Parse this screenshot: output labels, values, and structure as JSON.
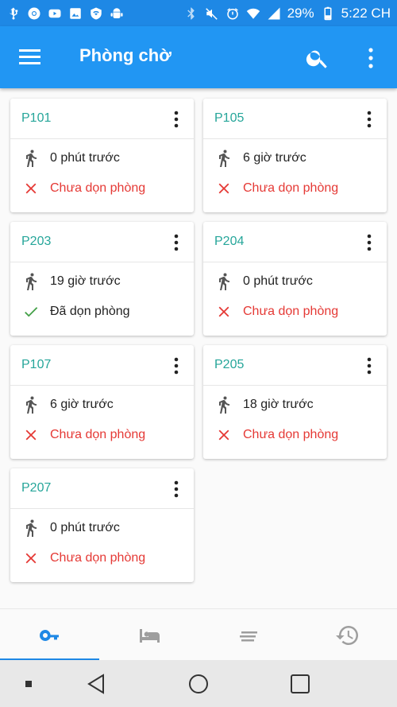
{
  "status_bar": {
    "battery": "29%",
    "time": "5:22 CH"
  },
  "app_bar": {
    "title": "Phòng chờ"
  },
  "rooms": [
    {
      "name": "P101",
      "time": "0 phút trước",
      "clean_status": "Chưa dọn phòng",
      "cleaned": false
    },
    {
      "name": "P105",
      "time": "6 giờ trước",
      "clean_status": "Chưa dọn phòng",
      "cleaned": false
    },
    {
      "name": "P203",
      "time": "19 giờ trước",
      "clean_status": "Đã dọn phòng",
      "cleaned": true
    },
    {
      "name": "P204",
      "time": "0 phút trước",
      "clean_status": "Chưa dọn phòng",
      "cleaned": false
    },
    {
      "name": "P107",
      "time": "6 giờ trước",
      "clean_status": "Chưa dọn phòng",
      "cleaned": false
    },
    {
      "name": "P205",
      "time": "18 giờ trước",
      "clean_status": "Chưa dọn phòng",
      "cleaned": false
    },
    {
      "name": "P207",
      "time": "0 phút trước",
      "clean_status": "Chưa dọn phòng",
      "cleaned": false
    }
  ],
  "bottom_nav": {
    "tabs": [
      {
        "icon": "key-icon",
        "active": true
      },
      {
        "icon": "bed-icon",
        "active": false
      },
      {
        "icon": "list-icon",
        "active": false
      },
      {
        "icon": "history-icon",
        "active": false
      }
    ]
  },
  "colors": {
    "primary": "#2196f3",
    "status_bar": "#1e88e5",
    "room_label": "#26a69a",
    "not_cleaned": "#e53935",
    "cleaned": "#43a047"
  }
}
